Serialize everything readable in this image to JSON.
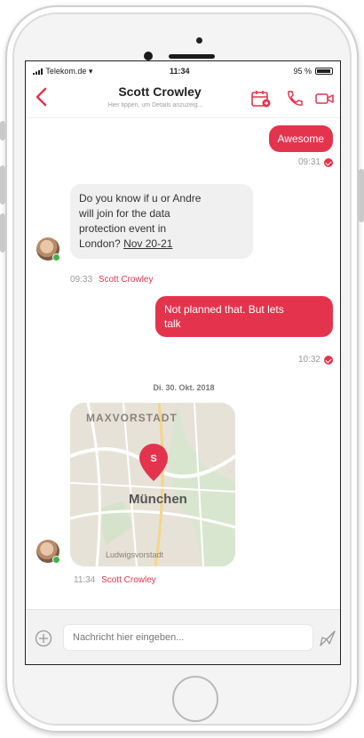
{
  "status": {
    "carrier": "Telekom.de",
    "time": "11:34",
    "battery": "95 %"
  },
  "header": {
    "contact_name": "Scott Crowley",
    "subtitle": "Hier tippen, um Details anzuzeig..."
  },
  "messages": {
    "m1": {
      "text": "Awesome",
      "time": "09:31"
    },
    "m2": {
      "line1": "Do you know if u or Andre",
      "line2": "will join for the data",
      "line3": "protection event in",
      "line4_prefix": "London?",
      "line4_date": "Nov 20-21",
      "time": "09:33",
      "sender": "Scott Crowley"
    },
    "m3": {
      "line1": "Not planned that. But lets",
      "line2": "talk",
      "time": "10:32"
    },
    "date_separator": "Di. 30. Okt. 2018",
    "m4": {
      "map_district": "MAXVORSTADT",
      "map_city": "München",
      "map_bottom": "Ludwigsvorstadt",
      "time": "11:34",
      "sender": "Scott Crowley"
    }
  },
  "composer": {
    "placeholder": "Nachricht hier eingeben..."
  },
  "colors": {
    "accent": "#e4344d",
    "bubble_in": "#f0f0f0",
    "online": "#3fb24a"
  }
}
